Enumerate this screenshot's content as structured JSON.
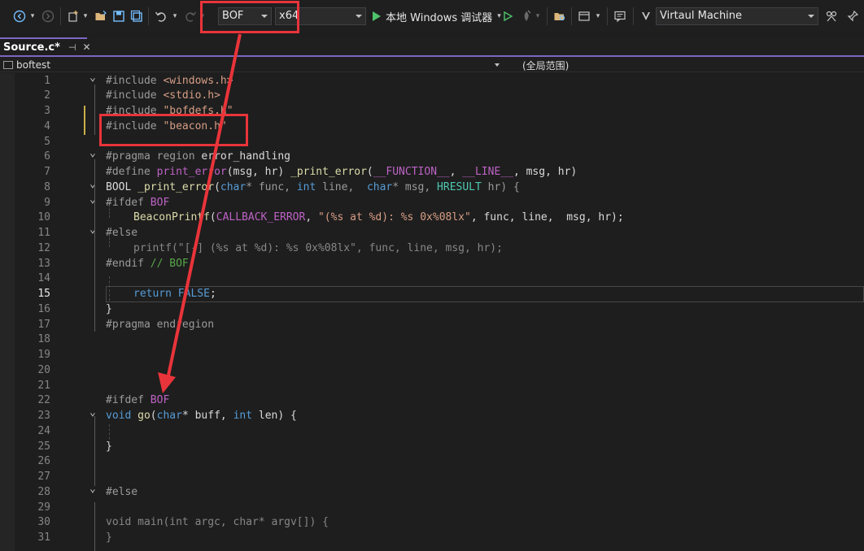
{
  "toolbar": {
    "configuration": "BOF",
    "platform": "x64",
    "debugger_label": "本地 Windows 调试器",
    "target_machine": "Virtaul Machine",
    "icons": [
      "nav-back-icon",
      "nav-forward-icon",
      "new-project-icon",
      "open-folder-icon",
      "save-icon",
      "save-all-icon",
      "undo-icon",
      "redo-icon",
      "start-without-debug-icon",
      "hot-reload-icon",
      "solution-explorer-icon",
      "window-layout-icon",
      "comment-icon",
      "vs-logo-icon",
      "remote-icon"
    ]
  },
  "tabs": [
    {
      "label": "Source.c*",
      "pin": "⊣",
      "close": "✕",
      "active": true
    }
  ],
  "navbar": {
    "project": "boftest",
    "scope": "(全局范围)"
  },
  "editor": {
    "current_line": 15,
    "lines": [
      {
        "n": "1"
      },
      {
        "n": "2"
      },
      {
        "n": "3"
      },
      {
        "n": "4"
      },
      {
        "n": "5"
      },
      {
        "n": "6"
      },
      {
        "n": "7"
      },
      {
        "n": "8"
      },
      {
        "n": "9"
      },
      {
        "n": "10"
      },
      {
        "n": "11"
      },
      {
        "n": "12"
      },
      {
        "n": "13"
      },
      {
        "n": "14"
      },
      {
        "n": "15"
      },
      {
        "n": "16"
      },
      {
        "n": "17"
      },
      {
        "n": "18"
      },
      {
        "n": "19"
      },
      {
        "n": "20"
      },
      {
        "n": "21"
      },
      {
        "n": "22"
      },
      {
        "n": "23"
      },
      {
        "n": "24"
      },
      {
        "n": "25"
      },
      {
        "n": "26"
      },
      {
        "n": "27"
      },
      {
        "n": "28"
      },
      {
        "n": "29"
      },
      {
        "n": "30"
      },
      {
        "n": "31"
      }
    ],
    "code": {
      "l1": [
        "#include ",
        "<windows.h>"
      ],
      "l2": [
        "#include ",
        "<stdio.h>"
      ],
      "l3": [
        "#include ",
        "\"bofdefs.h\""
      ],
      "l4": [
        "#include ",
        "\"beacon.h\""
      ],
      "l6": [
        "#pragma region ",
        "error_handling"
      ],
      "l7": [
        "#define ",
        "print_error",
        "(msg, hr) ",
        "_print_error",
        "(",
        "__FUNCTION__",
        ", ",
        "__LINE__",
        ", msg, hr)"
      ],
      "l8": [
        "BOOL ",
        "_print_error",
        "(",
        "char",
        "* func, ",
        "int",
        " line,  ",
        "char",
        "* msg, ",
        "HRESULT",
        " hr) {"
      ],
      "l9": [
        "#ifdef ",
        "BOF"
      ],
      "l10": [
        "BeaconPrintf",
        "(",
        "CALLBACK_ERROR",
        ", ",
        "\"(%s at %d): %s 0x%08lx\"",
        ", func, line,  msg, hr);"
      ],
      "l11": [
        "#else"
      ],
      "l12": [
        "printf(\"[-] (%s at %d): %s 0x%08lx\", func, line, msg, hr);"
      ],
      "l13": [
        "#endif ",
        "// BOF"
      ],
      "l15": [
        "return ",
        "FALSE",
        ";"
      ],
      "l16": [
        "}"
      ],
      "l17": [
        "#pragma endregion"
      ],
      "l22": [
        "#ifdef ",
        "BOF"
      ],
      "l23": [
        "void ",
        "go",
        "(",
        "char",
        "* buff, ",
        "int",
        " len) {"
      ],
      "l25": [
        "}"
      ],
      "l28": [
        "#else"
      ],
      "l30": [
        "void main(int argc, char* argv[]) {"
      ],
      "l31": [
        "}"
      ]
    }
  },
  "colors": {
    "annotation_red": "#e8343a",
    "accent_purple": "#7c67c4",
    "run_green": "#4ec36b"
  }
}
